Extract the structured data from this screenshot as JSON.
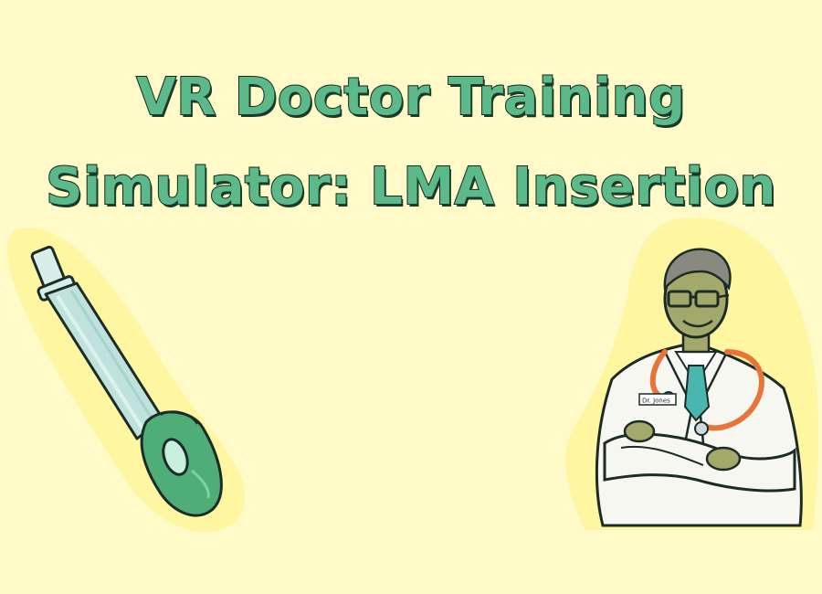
{
  "title": {
    "line1": "VR Doctor Training",
    "line2": "Simulator: LMA Insertion"
  },
  "illustrations": {
    "left": "laryngeal-mask-airway",
    "right": "doctor-with-stethoscope",
    "badge_text": "Dr. Jones"
  },
  "colors": {
    "background": "#fffac8",
    "title_fill": "#5bb98a",
    "title_outline": "#14281e",
    "lma_cuff": "#4fae78",
    "lma_tube": "#bfe3dc",
    "glow": "#fff59a",
    "stethoscope": "#e8743a",
    "tie": "#4ab6b0",
    "skin": "#a3a86b"
  }
}
